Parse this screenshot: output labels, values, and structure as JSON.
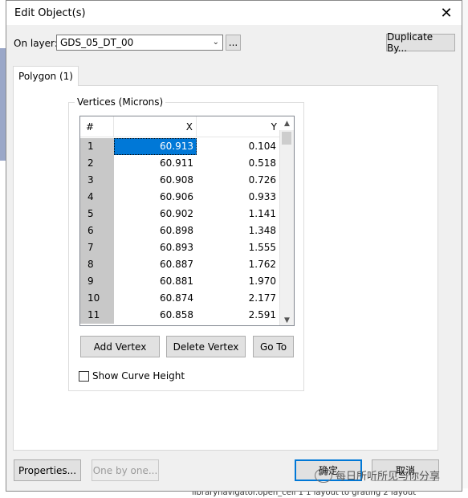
{
  "window": {
    "title": "Edit Object(s)",
    "close_glyph": "✕"
  },
  "layer": {
    "label": "On layer:",
    "value": "GDS_05_DT_00",
    "browse_label": "...",
    "duplicate_label": "Duplicate By..."
  },
  "tab": {
    "label": "Polygon (1)"
  },
  "vertices": {
    "group_title": "Vertices (Microns)",
    "columns": [
      "#",
      "X",
      "Y"
    ],
    "rows": [
      {
        "n": "1",
        "x": "60.913",
        "y": "0.104"
      },
      {
        "n": "2",
        "x": "60.911",
        "y": "0.518"
      },
      {
        "n": "3",
        "x": "60.908",
        "y": "0.726"
      },
      {
        "n": "4",
        "x": "60.906",
        "y": "0.933"
      },
      {
        "n": "5",
        "x": "60.902",
        "y": "1.141"
      },
      {
        "n": "6",
        "x": "60.898",
        "y": "1.348"
      },
      {
        "n": "7",
        "x": "60.893",
        "y": "1.555"
      },
      {
        "n": "8",
        "x": "60.887",
        "y": "1.762"
      },
      {
        "n": "9",
        "x": "60.881",
        "y": "1.970"
      },
      {
        "n": "10",
        "x": "60.874",
        "y": "2.177"
      },
      {
        "n": "11",
        "x": "60.858",
        "y": "2.591"
      }
    ],
    "selected_row": "1",
    "add_label": "Add Vertex",
    "delete_label": "Delete Vertex",
    "goto_label": "Go To",
    "show_curve_label": "Show Curve Height",
    "show_curve_checked": false
  },
  "footer": {
    "properties_label": "Properties...",
    "one_by_one_label": "One by one...",
    "ok_label": "确定",
    "cancel_label": "取消"
  },
  "background": {
    "status_text": "librarynavigator.open_cell 1 1 layout  to  grating  2 layout"
  },
  "watermark": {
    "text": "每日所听所见与你分享"
  }
}
